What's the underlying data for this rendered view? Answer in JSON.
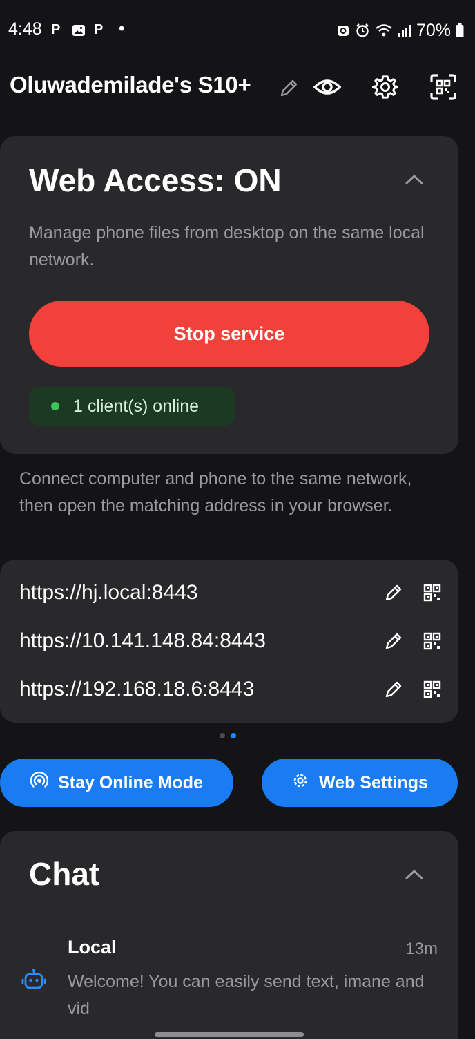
{
  "status_bar": {
    "time": "4:48",
    "notif_1": "P",
    "notif_3": "P",
    "notif_dot": "•",
    "battery": "70%"
  },
  "header": {
    "device_name": "Oluwademilade's S10+"
  },
  "web_access": {
    "title": "Web Access: ON",
    "description": "Manage phone files from desktop on the same local network.",
    "stop_button": "Stop service",
    "clients_status": "1 client(s) online"
  },
  "connect_instructions": "Connect computer and phone to the same network, then open the matching address in your browser.",
  "addresses": [
    {
      "url": "https://hj.local:8443"
    },
    {
      "url": "https://10.141.148.84:8443"
    },
    {
      "url": "https://192.168.18.6:8443"
    }
  ],
  "pager": {
    "pages": 2,
    "active": 2
  },
  "buttons": {
    "stay_online": "Stay Online Mode",
    "web_settings": "Web Settings"
  },
  "chat": {
    "title": "Chat",
    "items": [
      {
        "name": "Local",
        "time": "13m",
        "message": "Welcome! You can easily send text, imane and vid"
      }
    ]
  },
  "colors": {
    "background": "#141416",
    "card": "#29292b",
    "stop_red": "#f2403a",
    "accent_blue": "#1a7cf2",
    "online_green": "#3cc45a"
  },
  "icons": {
    "edit_name": "pencil-icon",
    "visibility": "eye-icon",
    "settings": "gear-icon",
    "scan": "qr-scan-icon",
    "collapse": "chevron-up-icon",
    "url_edit": "pencil-icon",
    "url_qr": "qr-code-icon",
    "stay_online": "broadcast-icon",
    "chat_bot": "robot-icon"
  }
}
